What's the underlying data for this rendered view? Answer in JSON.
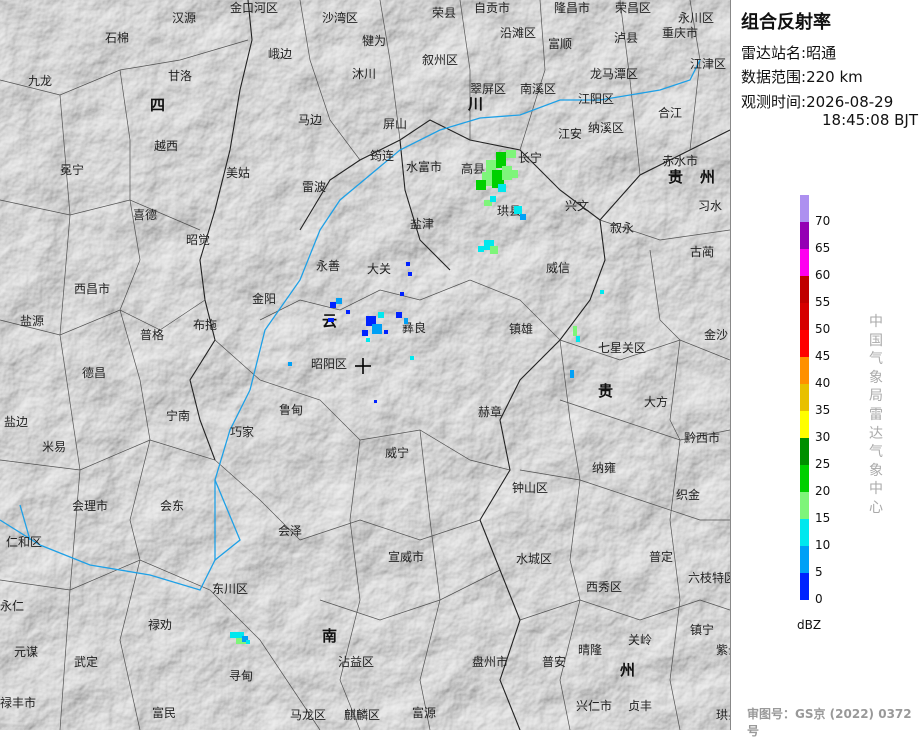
{
  "panel": {
    "title": "组合反射率",
    "station_label": "雷达站名:",
    "station_value": "昭通",
    "range_label": "数据范围:",
    "range_value": "220 km",
    "time_label": "观测时间:",
    "time_date": "2026-08-29",
    "time_clock": "18:45:08 BJT",
    "organization": "中国气象局雷达气象中心",
    "review_number": "审图号：GS京 (2022) 0372号"
  },
  "legend": {
    "unit": "dBZ",
    "labels": [
      "0",
      "5",
      "10",
      "15",
      "20",
      "25",
      "30",
      "35",
      "40",
      "45",
      "50",
      "55",
      "60",
      "65",
      "70"
    ],
    "colors": [
      "#0022ff",
      "#00a0f6",
      "#00e8ee",
      "#7ef57a",
      "#00d000",
      "#008f00",
      "#ffff00",
      "#e8c000",
      "#ff9000",
      "#ff0000",
      "#d60000",
      "#c00000",
      "#ff00f0",
      "#9400b4",
      "#ad90f0"
    ]
  },
  "map": {
    "places": [
      "汉源",
      "金口河区",
      "沙湾区",
      "荣县",
      "自贡市",
      "隆昌市",
      "荣昌区",
      "永川区",
      "石棉",
      "峨边",
      "犍为",
      "叙州区",
      "沿滩区",
      "富顺",
      "泸县",
      "重庆市",
      "九龙",
      "甘洛",
      "沐川",
      "翠屏区",
      "南溪区",
      "龙马潭区",
      "江津区",
      "马边",
      "屏山",
      "江阳区",
      "纳溪区",
      "合江",
      "越西",
      "筠连",
      "珙县",
      "长宁",
      "江安",
      "赤水市",
      "冕宁",
      "美姑",
      "雷波",
      "水富市",
      "高县",
      "兴文",
      "习水",
      "喜德",
      "昭觉",
      "盐津",
      "叙永",
      "古蔺",
      "永善",
      "大关",
      "威信",
      "西昌市",
      "金阳",
      "盐源",
      "普格",
      "布拖",
      "彝良",
      "镇雄",
      "金沙",
      "昭阳区",
      "七星关区",
      "德昌",
      "鲁甸",
      "大方",
      "宁南",
      "巧家",
      "赫章",
      "盐边",
      "米易",
      "黔西市",
      "威宁",
      "纳雍",
      "会理市",
      "会东",
      "钟山区",
      "织金",
      "仁和区",
      "会泽",
      "宣威市",
      "水城区",
      "普定",
      "六枝特区",
      "西秀区",
      "东川区",
      "禄劝",
      "关岭",
      "镇宁",
      "元谋",
      "武定",
      "沾益区",
      "盘州市",
      "普安",
      "晴隆",
      "紫云",
      "寻甸",
      "富民",
      "马龙区",
      "麒麟区",
      "富源",
      "兴仁市",
      "贞丰",
      "永仁",
      "禄丰市",
      "珙县"
    ],
    "regions": [
      "四",
      "川",
      "贵",
      "州",
      "云",
      "南",
      "贵",
      "州"
    ]
  }
}
